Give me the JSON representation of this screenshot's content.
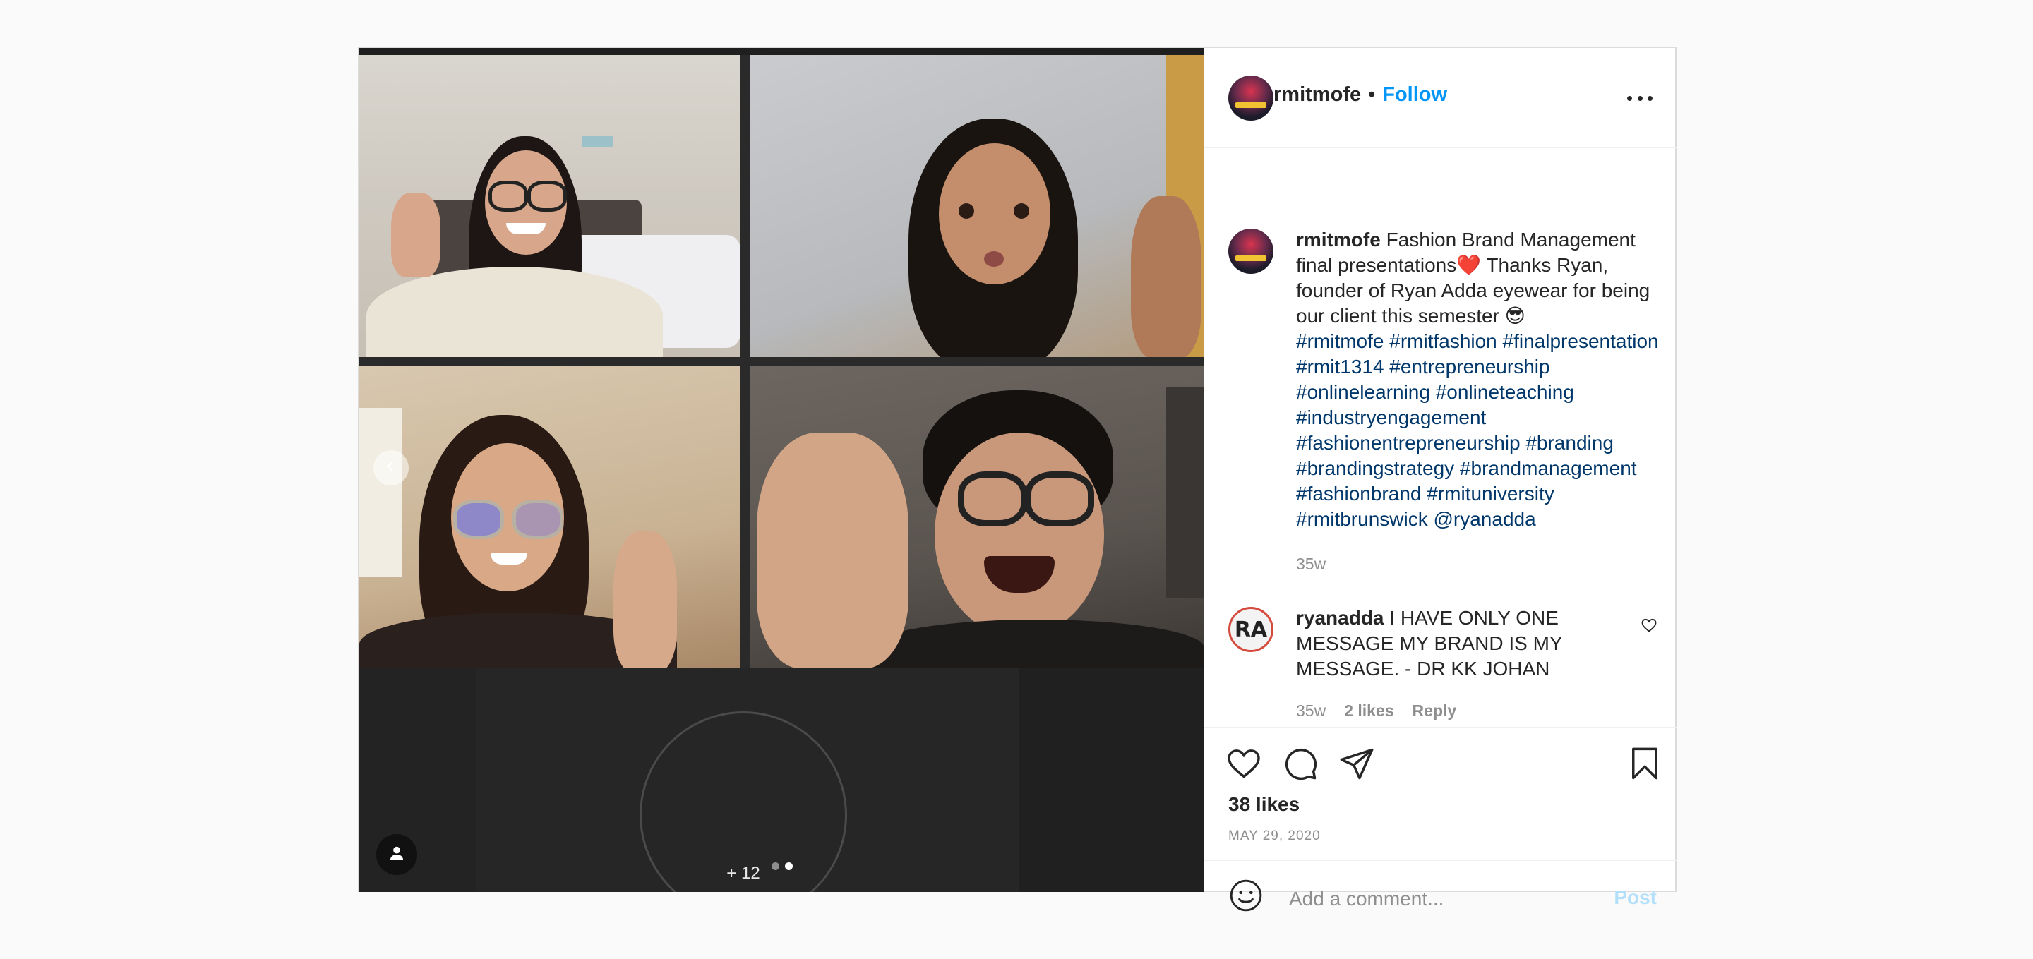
{
  "post": {
    "username": "rmitmofe",
    "separator": "•",
    "follow_label": "Follow",
    "more_options_icon": "more-horizontal-icon"
  },
  "media": {
    "more_participants": "+ 12",
    "carousel_total": 2,
    "carousel_active": 2,
    "prev_icon": "chevron-left-icon",
    "tag_icon": "user-tag-icon"
  },
  "caption": {
    "username": "rmitmofe",
    "text_part1": " Fashion Brand Management final presentations",
    "emoji_heart": "❤️",
    "text_part2": " Thanks Ryan, founder of Ryan Adda eyewear for being our client this semester ",
    "emoji_sunglasses": "😎",
    "hashtags": "#rmitmofe #rmitfashion #finalpresentation #rmit1314 #entrepreneurship #onlinelearning #onlineteaching #industryengagement #fashionentrepreneurship #branding #brandingstrategy #brandmanagement #fashionbrand #rmituniversity #rmitbrunswick @ryanadda",
    "time": "35w"
  },
  "comment": {
    "avatar_text": "RA",
    "username": "ryanadda",
    "text": " I HAVE ONLY ONE MESSAGE MY BRAND IS MY MESSAGE. - DR KK JOHAN",
    "time": "35w",
    "likes": "2 likes",
    "reply_label": "Reply"
  },
  "actions": {
    "likes": "38 likes",
    "date": "MAY 29, 2020"
  },
  "add_comment": {
    "placeholder": "Add a comment...",
    "post_label": "Post"
  },
  "colors": {
    "link": "#0095f6",
    "hashtag": "#00376b",
    "post_disabled": "#b2dffc"
  }
}
